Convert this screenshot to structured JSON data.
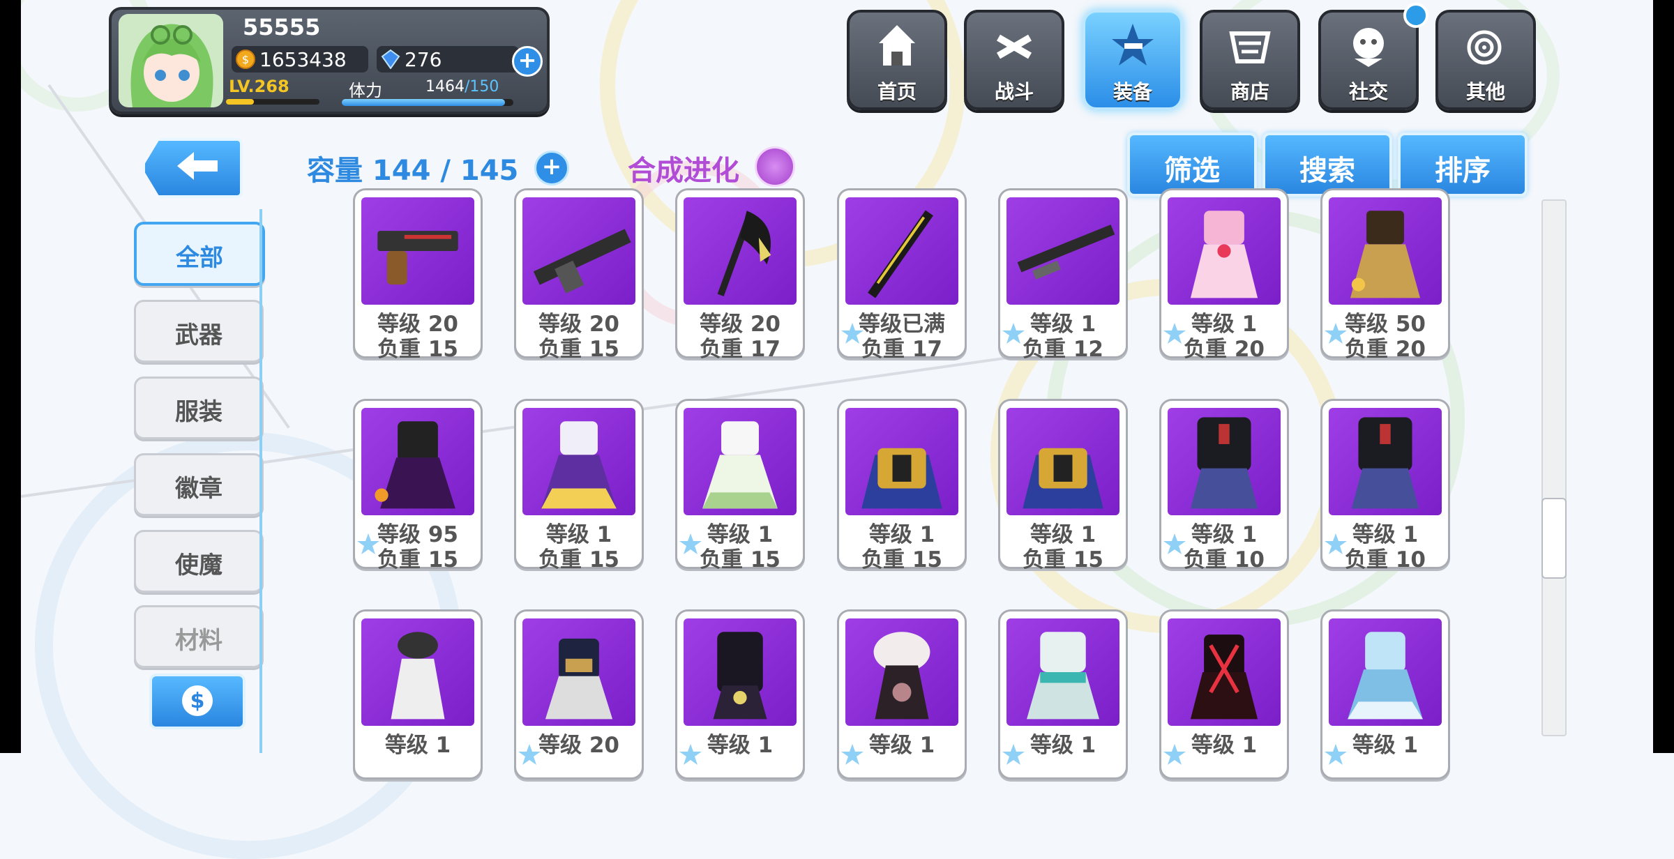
{
  "player": {
    "name": "55555",
    "gold": "1653438",
    "gems": "276",
    "level": "LV.268",
    "level_progress": 0.3,
    "stamina_label": "体力",
    "stamina_current": "1464",
    "stamina_max": "/150",
    "stamina_progress": 0.95
  },
  "nav": {
    "items": [
      {
        "label": "首页",
        "icon": "home-icon"
      },
      {
        "label": "战斗",
        "icon": "battle-icon"
      },
      {
        "label": "装备",
        "icon": "equipment-icon",
        "active": true
      },
      {
        "label": "商店",
        "icon": "shop-icon"
      },
      {
        "label": "社交",
        "icon": "social-icon"
      },
      {
        "label": "其他",
        "icon": "other-icon"
      }
    ]
  },
  "categories": [
    {
      "label": "全部",
      "active": true
    },
    {
      "label": "武器"
    },
    {
      "label": "服装"
    },
    {
      "label": "徽章"
    },
    {
      "label": "使魔"
    },
    {
      "label": "材料",
      "disabled": true
    }
  ],
  "header": {
    "capacity": "容量 144 / 145",
    "evolve": "合成进化",
    "filter": "筛选",
    "search": "搜索",
    "sort": "排序"
  },
  "items": [
    {
      "level": "等级 20",
      "weight": "负重 15",
      "kind": "pistol"
    },
    {
      "level": "等级 20",
      "weight": "负重 15",
      "kind": "rifle"
    },
    {
      "level": "等级 20",
      "weight": "负重 17",
      "kind": "axe"
    },
    {
      "level": "等级已满",
      "weight": "负重 17",
      "kind": "sword"
    },
    {
      "level": "等级 1",
      "weight": "负重 12",
      "kind": "gun"
    },
    {
      "level": "等级 1",
      "weight": "负重 20",
      "kind": "dress-pink"
    },
    {
      "level": "等级 50",
      "weight": "负重 20",
      "kind": "dress-gold"
    },
    {
      "level": "等级 95",
      "weight": "负重 15",
      "kind": "dress-dark"
    },
    {
      "level": "等级 1",
      "weight": "负重 15",
      "kind": "dress-purple"
    },
    {
      "level": "等级 1",
      "weight": "负重 15",
      "kind": "dress-green"
    },
    {
      "level": "等级 1",
      "weight": "负重 15",
      "kind": "armor-feather"
    },
    {
      "level": "等级 1",
      "weight": "负重 15",
      "kind": "armor-feather"
    },
    {
      "level": "等级 1",
      "weight": "负重 10",
      "kind": "uniform"
    },
    {
      "level": "等级 1",
      "weight": "负重 10",
      "kind": "uniform"
    },
    {
      "level": "等级 1",
      "weight": "",
      "kind": "outfit-white"
    },
    {
      "level": "等级 20",
      "weight": "",
      "kind": "outfit-navy"
    },
    {
      "level": "等级 1",
      "weight": "",
      "kind": "outfit-black"
    },
    {
      "level": "等级 1",
      "weight": "",
      "kind": "outfit-fur"
    },
    {
      "level": "等级 1",
      "weight": "",
      "kind": "outfit-teal"
    },
    {
      "level": "等级 1",
      "weight": "",
      "kind": "outfit-red"
    },
    {
      "level": "等级 1",
      "weight": "",
      "kind": "outfit-blue"
    }
  ],
  "colors": {
    "accent": "#2d8ae0",
    "card_bg": "#8e2fd8",
    "evolve": "#b04cd6"
  }
}
